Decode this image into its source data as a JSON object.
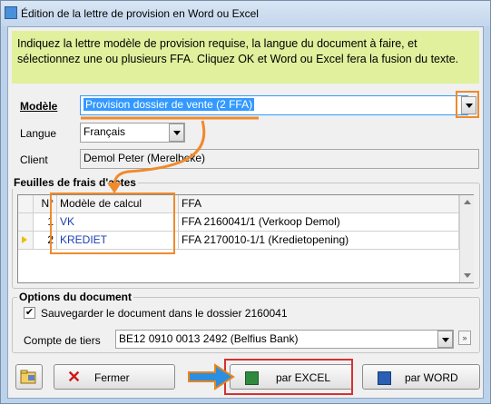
{
  "window": {
    "title": "Édition de la lettre de provision en Word ou Excel"
  },
  "instructions": "Indiquez la lettre modèle de provision requise, la langue du document à faire, et sélectionnez une ou plusieurs FFA.  Cliquez OK et Word ou Excel fera la fusion du texte.",
  "form": {
    "model_label": "Modèle",
    "model_value": "Provision dossier de vente (2 FFA)",
    "language_label": "Langue",
    "language_value": "Français",
    "client_label": "Client",
    "client_value": "Demol Peter (Merelbeke)"
  },
  "sheets": {
    "title": "Feuilles de frais d'actes",
    "columns": [
      "N°",
      "Modèle de calcul",
      "FFA"
    ],
    "rows": [
      {
        "num": "1",
        "model": "VK",
        "ffa": "FFA 2160041/1 (Verkoop Demol)"
      },
      {
        "num": "2",
        "model": "KREDIET",
        "ffa": "FFA 2170010-1/1 (Kredietopening)"
      }
    ]
  },
  "options": {
    "title": "Options du document",
    "save_checkbox_label": "Sauvegarder le document dans le dossier 2160041",
    "save_checked": true,
    "account_label": "Compte de tiers",
    "account_value": "BE12 0910 0013 2492 (Belfius Bank)"
  },
  "buttons": {
    "close_label": "Fermer",
    "excel_label": "par EXCEL",
    "word_label": "par WORD"
  },
  "colors": {
    "highlight_orange": "#f08a2b",
    "highlight_red": "#d83030",
    "arrow_blue": "#2a8fe0",
    "instruction_bg": "#e0f09c",
    "selection_blue": "#3399ff"
  }
}
